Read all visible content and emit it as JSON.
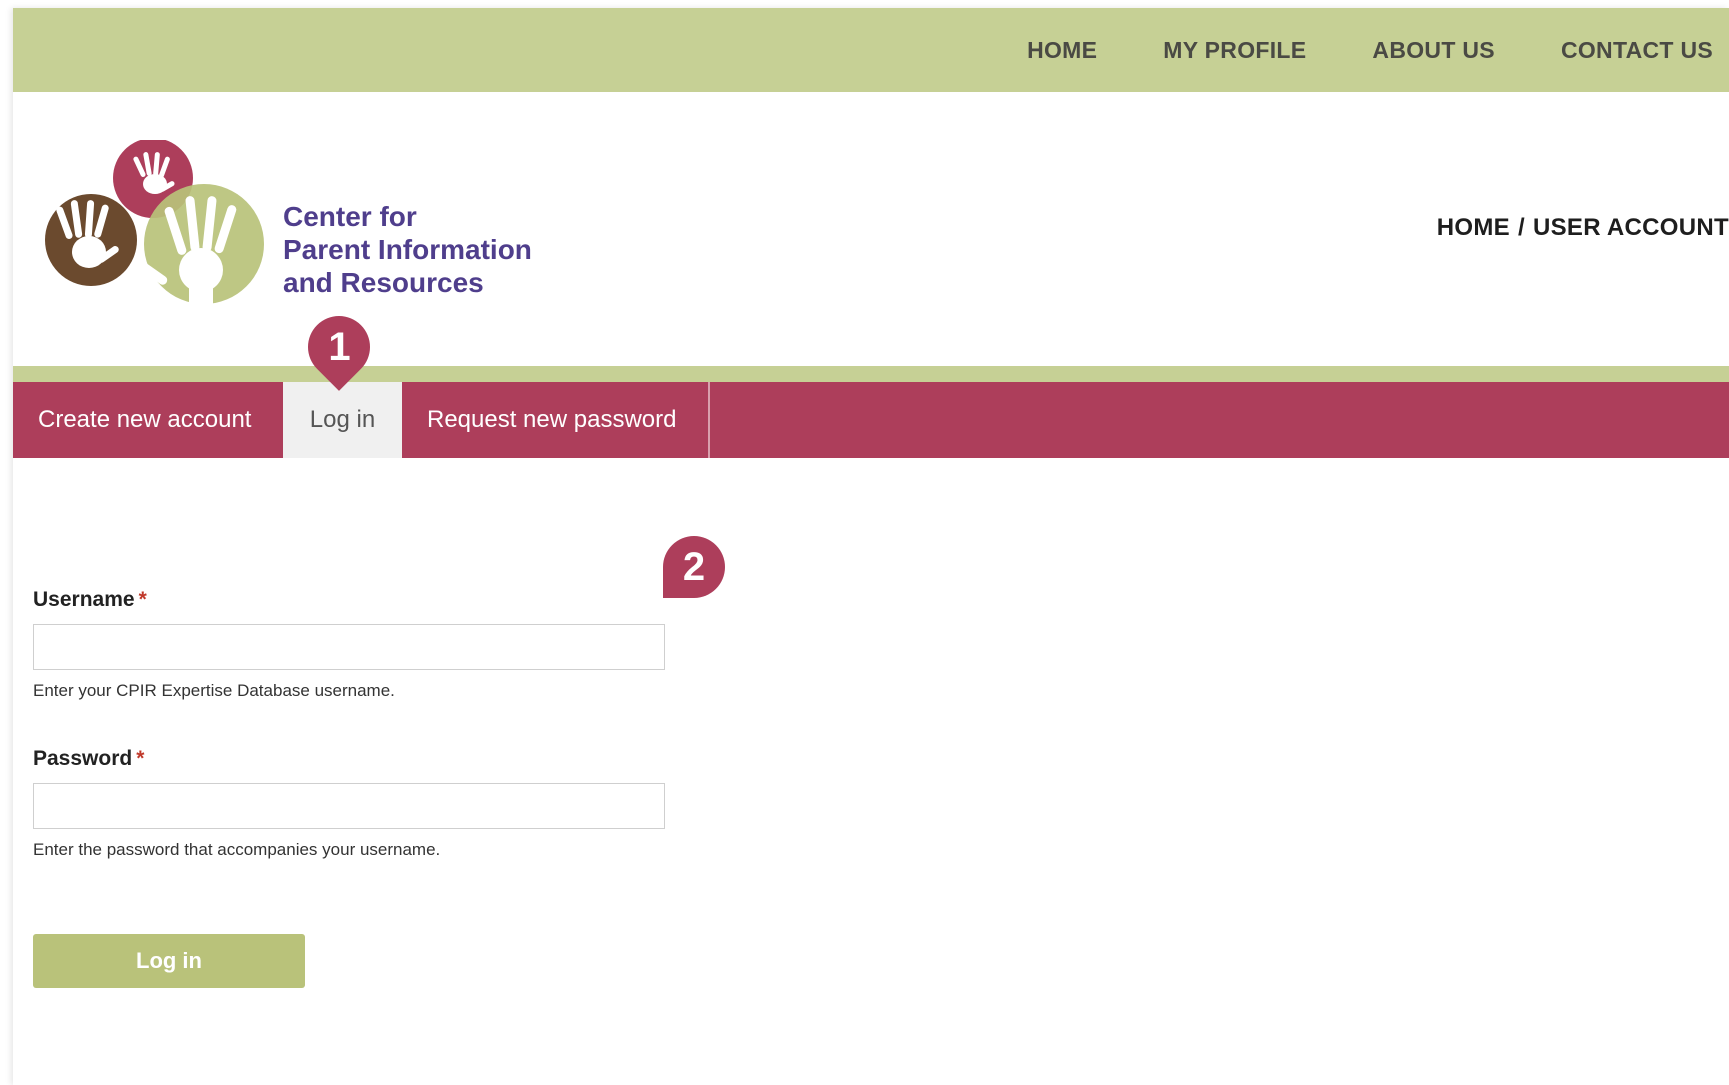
{
  "topnav": {
    "items": [
      {
        "label": "HOME"
      },
      {
        "label": "MY PROFILE"
      },
      {
        "label": "ABOUT US"
      },
      {
        "label": "CONTACT US"
      }
    ]
  },
  "header": {
    "org_name_lines": [
      "Center for",
      "Parent Information",
      "and Resources"
    ],
    "breadcrumb": {
      "home": "HOME",
      "separator": "/",
      "current": "USER ACCOUNT"
    }
  },
  "tabs": [
    {
      "label": "Create new account",
      "active": false
    },
    {
      "label": "Log in",
      "active": true
    },
    {
      "label": "Request new password",
      "active": false
    }
  ],
  "callouts": [
    "1",
    "2"
  ],
  "form": {
    "username": {
      "label": "Username",
      "required_mark": "*",
      "value": "",
      "help": "Enter your CPIR Expertise Database username."
    },
    "password": {
      "label": "Password",
      "required_mark": "*",
      "value": "",
      "help": "Enter the password that accompanies your username."
    },
    "submit_label": "Log in"
  },
  "colors": {
    "olive": "#c6d095",
    "button_olive": "#b9c27a",
    "crimson": "#ad3e5b",
    "purple": "#4f3e8c",
    "brown": "#6b4a2e"
  },
  "icons": [
    "hands-logo-icon"
  ]
}
